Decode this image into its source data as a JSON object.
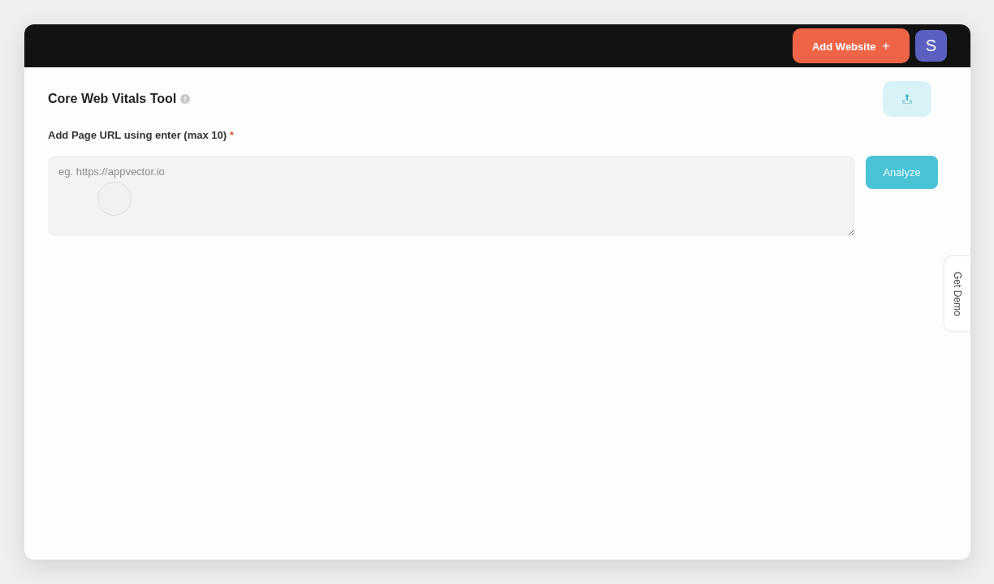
{
  "header": {
    "add_button": {
      "label": "Add Website",
      "icon": "+"
    },
    "avatar": {
      "initial": "S"
    }
  },
  "page": {
    "title": "Core Web Vitals Tool"
  },
  "url_field": {
    "label": "Add Page URL using enter (max 10)",
    "required_mark": "*",
    "placeholder": "eg. https://appvector.io"
  },
  "analyze_button": {
    "label": "Analyze"
  },
  "side_tab": {
    "label": "Get Demo"
  }
}
